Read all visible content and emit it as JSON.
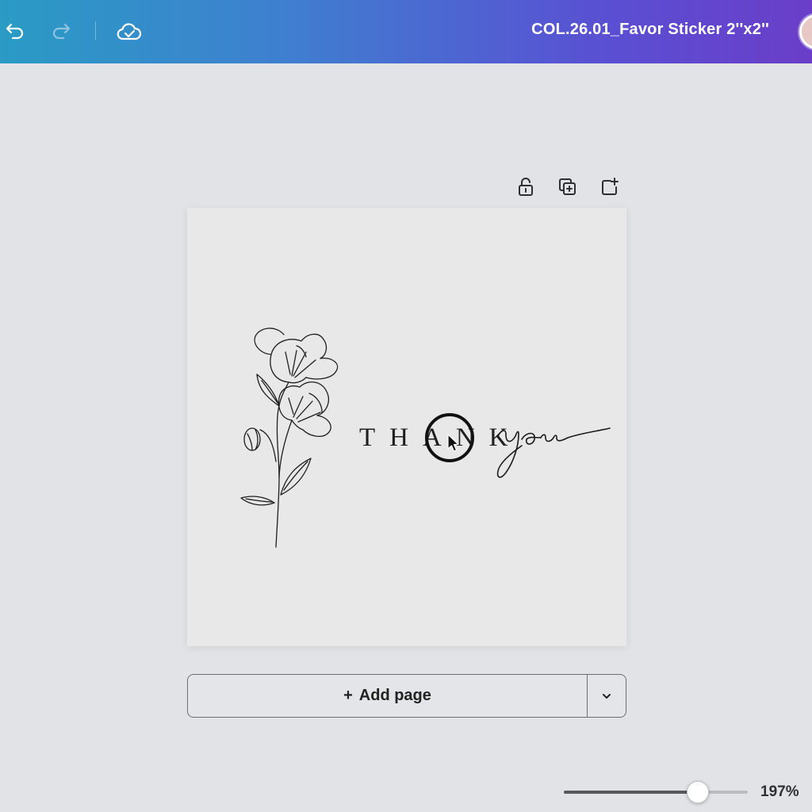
{
  "topbar": {
    "doc_title": "COL.26.01_Favor Sticker 2''x2''",
    "icons": [
      "undo-icon",
      "redo-icon",
      "cloud-saved-icon"
    ]
  },
  "page_toolbar": {
    "icons": [
      "lock-icon",
      "duplicate-page-icon",
      "add-page-icon"
    ]
  },
  "canvas": {
    "thank_text": "THANK",
    "you_script": "you"
  },
  "add_page": {
    "plus": "+",
    "label": "Add page"
  },
  "zoom": {
    "level_label": "197%",
    "slider_fraction": 0.73
  },
  "colors": {
    "bar_gradient_start": "#2a9bc4",
    "bar_gradient_end": "#6a3ec9",
    "workspace": "#e1e3e6",
    "page": "#e8e8e9"
  }
}
